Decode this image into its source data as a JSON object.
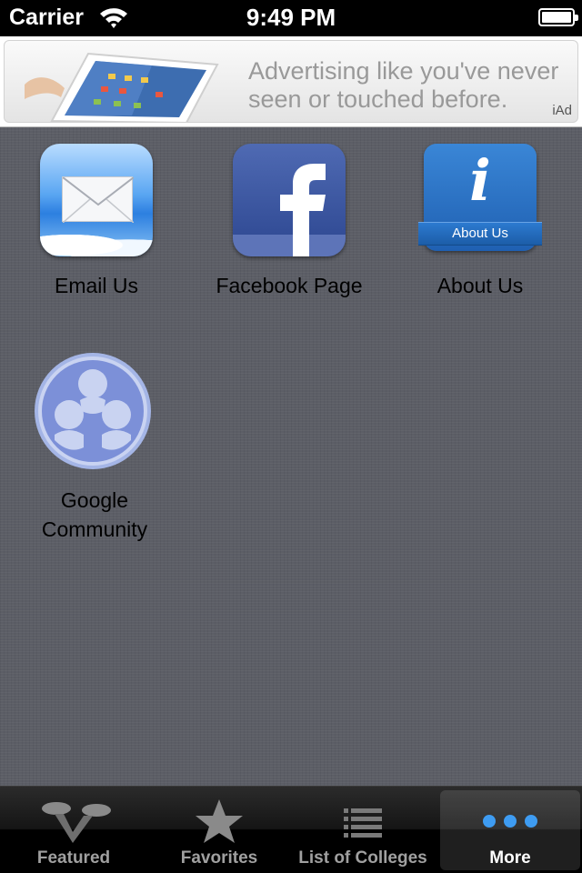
{
  "status_bar": {
    "carrier": "Carrier",
    "time": "9:49 PM"
  },
  "ad": {
    "line1": "Advertising like you've never",
    "line2": "seen or touched before.",
    "badge": "iAd"
  },
  "grid": {
    "items": [
      {
        "label": "Email Us",
        "icon": "mail-icon"
      },
      {
        "label": "Facebook Page",
        "icon": "facebook-icon"
      },
      {
        "label": "About Us",
        "icon": "about-us-icon",
        "ribbon_text": "About Us"
      },
      {
        "label_line1": "Google",
        "label_line2": "Community",
        "icon": "community-icon"
      }
    ]
  },
  "tab_bar": {
    "tabs": [
      {
        "label": "Featured",
        "icon": "featured-icon"
      },
      {
        "label": "Favorites",
        "icon": "star-icon"
      },
      {
        "label": "List of Colleges",
        "icon": "list-icon"
      },
      {
        "label": "More",
        "icon": "more-icon"
      }
    ],
    "active_tab": "More"
  },
  "colors": {
    "background": "#5c5e66",
    "active_tab_dot": "#3e9cf2",
    "tab_label": "#a0a0a0"
  }
}
